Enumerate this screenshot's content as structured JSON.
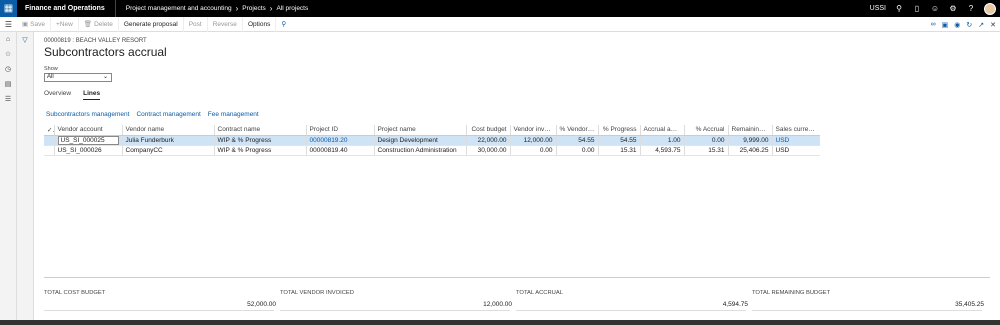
{
  "topbar": {
    "app_title": "Finance and Operations",
    "breadcrumbs": [
      "Project management and accounting",
      "Projects",
      "All projects"
    ],
    "company": "USSI"
  },
  "actionbar": {
    "save": "Save",
    "new": "+New",
    "delete": "Delete",
    "generate_proposal": "Generate proposal",
    "post": "Post",
    "reverse": "Reverse",
    "options": "Options"
  },
  "page": {
    "caption": "00000819 : BEACH VALLEY RESORT",
    "title": "Subcontractors accrual",
    "show_label": "Show",
    "show_value": "All",
    "tabs": [
      "Overview",
      "Lines"
    ],
    "links": [
      "Subcontractors management",
      "Contract management",
      "Fee management"
    ]
  },
  "grid": {
    "columns": [
      "Vendor account",
      "Vendor name",
      "Contract name",
      "Project ID",
      "Project name",
      "Cost budget",
      "Vendor invoi...",
      "% Vendor inv...",
      "% Progress",
      "Accrual amo...",
      "% Accrual",
      "Remaining b...",
      "Sales currency"
    ],
    "rows": [
      [
        "US_SI_000025",
        "Julia Funderburk",
        "WIP & % Progress",
        "00000819.20",
        "Design Development",
        "22,000.00",
        "12,000.00",
        "54.55",
        "54.55",
        "1.00",
        "0.00",
        "9,999.00",
        "USD"
      ],
      [
        "US_SI_000026",
        "CompanyCC",
        "WIP & % Progress",
        "00000819.40",
        "Construction Administration",
        "30,000.00",
        "0.00",
        "0.00",
        "15.31",
        "4,593.75",
        "15.31",
        "25,406.25",
        "USD"
      ]
    ]
  },
  "totals": [
    {
      "label": "TOTAL COST BUDGET",
      "value": "52,000.00"
    },
    {
      "label": "TOTAL VENDOR INVOICED",
      "value": "12,000.00"
    },
    {
      "label": "TOTAL ACCRUAL",
      "value": "4,594.75"
    },
    {
      "label": "TOTAL REMAINING BUDGET",
      "value": "35,405.25"
    }
  ]
}
